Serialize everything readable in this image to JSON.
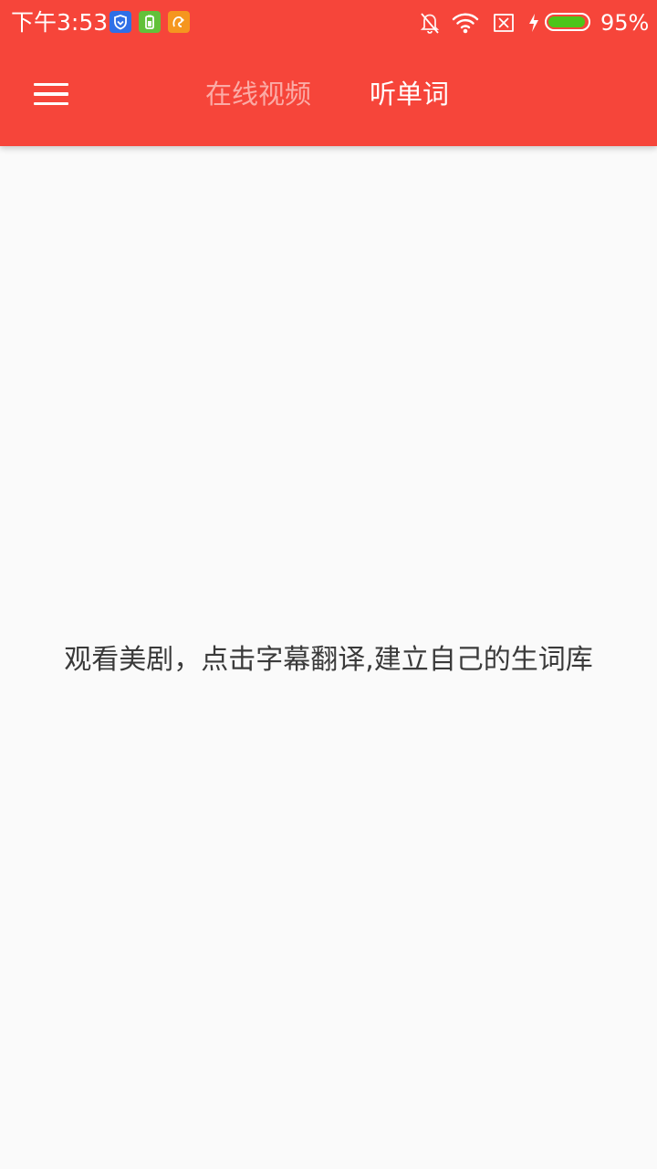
{
  "status_bar": {
    "time": "下午3:53",
    "battery_percent_text": "95%",
    "battery_level": 0.95,
    "icons": [
      "shield-app-icon",
      "battery-app-icon",
      "squirrel-app-icon",
      "bell-muted-icon",
      "wifi-icon",
      "no-sim-icon",
      "charging-icon",
      "battery-icon"
    ]
  },
  "toolbar": {
    "menu_icon": "hamburger-menu-icon",
    "tabs": [
      {
        "label": "在线视频",
        "selected": false
      },
      {
        "label": "听单词",
        "selected": true
      }
    ]
  },
  "main": {
    "message": "观看美剧，点击字幕翻译,建立自己的生词库"
  },
  "colors": {
    "app_bar": "#f6453a",
    "background": "#fafafa",
    "message_text": "#3a3a3a",
    "battery_fill": "#4cc51a"
  }
}
